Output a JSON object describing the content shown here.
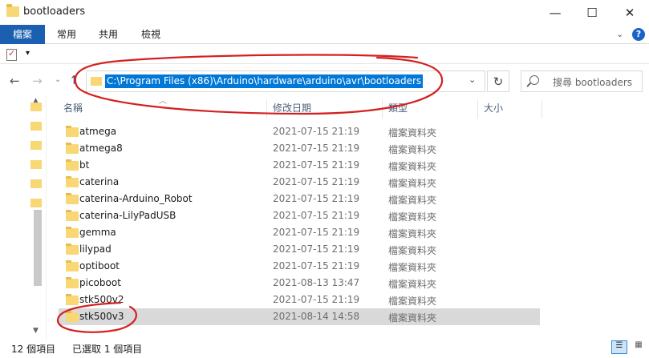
{
  "window": {
    "title": "bootloaders"
  },
  "ribbon": {
    "tabs": [
      "檔案",
      "常用",
      "共用",
      "檢視"
    ]
  },
  "address": {
    "path": "C:\\Program Files (x86)\\Arduino\\hardware\\arduino\\avr\\bootloaders"
  },
  "search": {
    "placeholder": "搜尋 bootloaders"
  },
  "columns": [
    "名稱",
    "修改日期",
    "類型",
    "大小"
  ],
  "rows": [
    {
      "name": "atmega",
      "date": "2021-07-15 21:19",
      "type": "檔案資料夾"
    },
    {
      "name": "atmega8",
      "date": "2021-07-15 21:19",
      "type": "檔案資料夾"
    },
    {
      "name": "bt",
      "date": "2021-07-15 21:19",
      "type": "檔案資料夾"
    },
    {
      "name": "caterina",
      "date": "2021-07-15 21:19",
      "type": "檔案資料夾"
    },
    {
      "name": "caterina-Arduino_Robot",
      "date": "2021-07-15 21:19",
      "type": "檔案資料夾"
    },
    {
      "name": "caterina-LilyPadUSB",
      "date": "2021-07-15 21:19",
      "type": "檔案資料夾"
    },
    {
      "name": "gemma",
      "date": "2021-07-15 21:19",
      "type": "檔案資料夾"
    },
    {
      "name": "lilypad",
      "date": "2021-07-15 21:19",
      "type": "檔案資料夾"
    },
    {
      "name": "optiboot",
      "date": "2021-07-15 21:19",
      "type": "檔案資料夾"
    },
    {
      "name": "picoboot",
      "date": "2021-08-13 13:47",
      "type": "檔案資料夾"
    },
    {
      "name": "stk500v2",
      "date": "2021-07-15 21:19",
      "type": "檔案資料夾"
    },
    {
      "name": "stk500v3",
      "date": "2021-08-14 14:58",
      "type": "檔案資料夾",
      "selected": true
    }
  ],
  "status": {
    "count": "12 個項目",
    "selected": "已選取 1 個項目"
  },
  "colors": {
    "accent": "#1a5fb0",
    "selection": "#0078d7",
    "annotation": "#d42020",
    "folder": "#f8d775"
  }
}
